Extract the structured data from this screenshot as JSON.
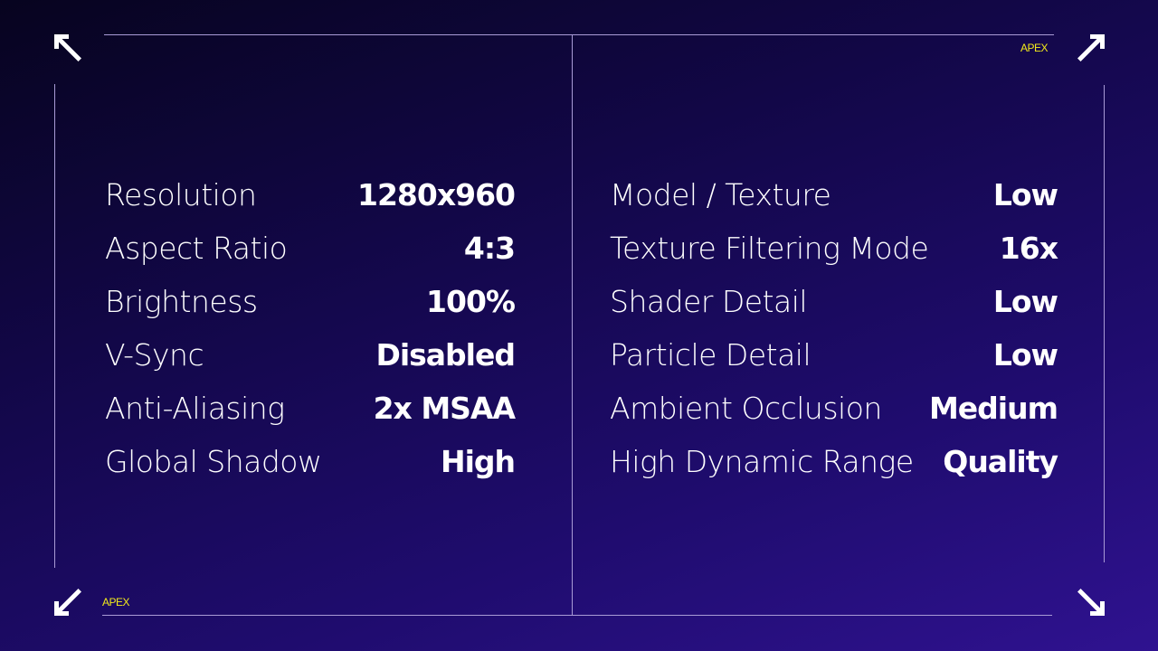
{
  "brand": {
    "top_right": "APEX",
    "bottom_left": "APEX"
  },
  "icons": {
    "top_left": "arrow-up-left-icon",
    "top_right": "arrow-up-right-icon",
    "bottom_left": "arrow-down-left-icon",
    "bottom_right": "arrow-down-right-icon"
  },
  "left_settings": [
    {
      "label": "Resolution",
      "value": "1280x960"
    },
    {
      "label": "Aspect Ratio",
      "value": "4:3"
    },
    {
      "label": "Brightness",
      "value": "100%"
    },
    {
      "label": "V-Sync",
      "value": "Disabled"
    },
    {
      "label": "Anti-Aliasing",
      "value": "2x MSAA"
    },
    {
      "label": "Global Shadow",
      "value": "High"
    }
  ],
  "right_settings": [
    {
      "label": "Model / Texture",
      "value": "Low"
    },
    {
      "label": "Texture Filtering Mode",
      "value": "16x"
    },
    {
      "label": "Shader Detail",
      "value": "Low"
    },
    {
      "label": "Particle Detail",
      "value": "Low"
    },
    {
      "label": "Ambient Occlusion",
      "value": "Medium"
    },
    {
      "label": "High Dynamic Range",
      "value": "Quality"
    }
  ]
}
